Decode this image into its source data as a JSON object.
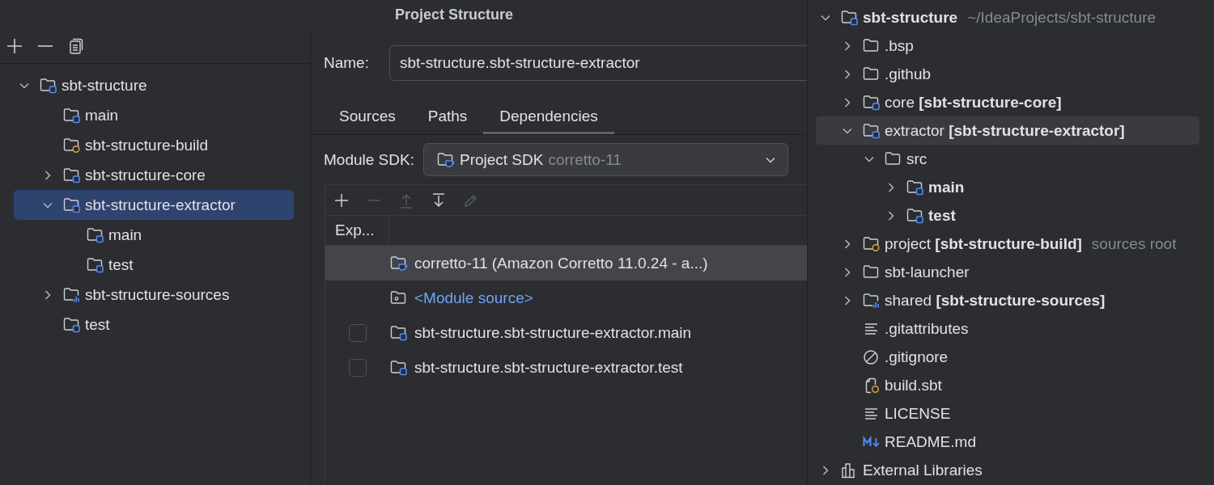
{
  "dialog": {
    "title": "Project Structure",
    "modules": [
      {
        "name": "sbt-structure",
        "kind": "module",
        "expanded": true,
        "selected": false,
        "children": [
          {
            "name": "main",
            "kind": "module",
            "selected": false
          },
          {
            "name": "sbt-structure-build",
            "kind": "build",
            "selected": false
          },
          {
            "name": "sbt-structure-core",
            "kind": "module",
            "expanded": false,
            "selected": false
          },
          {
            "name": "sbt-structure-extractor",
            "kind": "module",
            "expanded": true,
            "selected": true,
            "children": [
              {
                "name": "main",
                "kind": "module",
                "selected": false
              },
              {
                "name": "test",
                "kind": "module",
                "selected": false
              }
            ]
          },
          {
            "name": "sbt-structure-sources",
            "kind": "sources",
            "expanded": false,
            "selected": false
          },
          {
            "name": "test",
            "kind": "module",
            "selected": false
          }
        ]
      }
    ],
    "name_field": {
      "label": "Name:",
      "value": "sbt-structure.sbt-structure-extractor"
    },
    "tabs": [
      {
        "label": "Sources",
        "selected": false
      },
      {
        "label": "Paths",
        "selected": false
      },
      {
        "label": "Dependencies",
        "selected": true
      }
    ],
    "module_sdk": {
      "label": "Module SDK:",
      "value": "Project SDK",
      "detail": "corretto-11"
    },
    "dependency_toolbar": [
      {
        "kind": "add",
        "disabled": false
      },
      {
        "kind": "remove",
        "disabled": true
      },
      {
        "kind": "move-up",
        "disabled": true
      },
      {
        "kind": "move-down",
        "disabled": false
      },
      {
        "kind": "edit",
        "disabled": true
      }
    ],
    "dependencies": {
      "columns": [
        "Exp..."
      ],
      "rows": [
        {
          "kind": "sdk",
          "name": "corretto-11 (Amazon Corretto 11.0.24 - a...)",
          "selected": true
        },
        {
          "kind": "module-source",
          "name": "<Module source>",
          "selected": false
        },
        {
          "kind": "module",
          "name": "sbt-structure.sbt-structure-extractor.main",
          "checked": false,
          "selected": false
        },
        {
          "kind": "module",
          "name": "sbt-structure.sbt-structure-extractor.test",
          "checked": false,
          "selected": false
        }
      ]
    }
  },
  "project_tree": [
    {
      "name": "sbt-structure",
      "bold": true,
      "hint": "~/IdeaProjects/sbt-structure",
      "kind": "module",
      "expanded": true,
      "selected": false,
      "children": [
        {
          "name": ".bsp",
          "kind": "folder",
          "expanded": false,
          "selected": false
        },
        {
          "name": ".github",
          "kind": "folder",
          "expanded": false,
          "selected": false
        },
        {
          "name": "core **[sbt-structure-core]**",
          "kind": "module",
          "expanded": false,
          "selected": false
        },
        {
          "name": "extractor **[sbt-structure-extractor]**",
          "kind": "module",
          "expanded": true,
          "selected": true,
          "children": [
            {
              "name": "src",
              "kind": "folder",
              "expanded": true,
              "selected": false,
              "children": [
                {
                  "name": "main",
                  "bold": true,
                  "kind": "module",
                  "expanded": false,
                  "selected": false
                },
                {
                  "name": "test",
                  "bold": true,
                  "kind": "module",
                  "expanded": false,
                  "selected": false
                }
              ]
            }
          ]
        },
        {
          "name": "project **[sbt-structure-build]**",
          "hint": "sources root",
          "kind": "build",
          "expanded": false,
          "selected": false
        },
        {
          "name": "sbt-launcher",
          "kind": "folder",
          "expanded": false,
          "selected": false
        },
        {
          "name": "shared **[sbt-structure-sources]**",
          "kind": "sources",
          "expanded": false,
          "selected": false
        },
        {
          "name": ".gitattributes",
          "kind": "text",
          "selected": false
        },
        {
          "name": ".gitignore",
          "kind": "ignore",
          "selected": false
        },
        {
          "name": "build.sbt",
          "kind": "sbt",
          "selected": false
        },
        {
          "name": "LICENSE",
          "kind": "text",
          "selected": false
        },
        {
          "name": "README.md",
          "kind": "markdown",
          "selected": false
        }
      ]
    },
    {
      "name": "External Libraries",
      "kind": "libraries",
      "expanded": false,
      "selected": false
    }
  ]
}
